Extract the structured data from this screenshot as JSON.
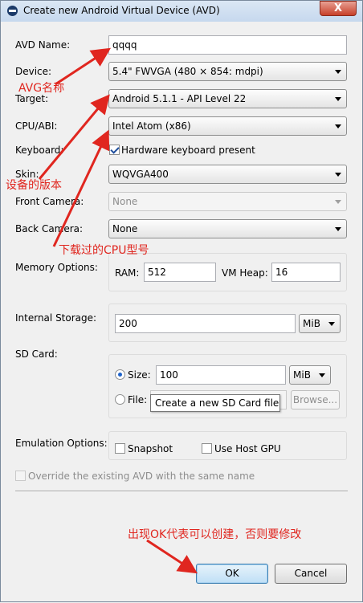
{
  "window": {
    "title": "Create new Android Virtual Device (AVD)",
    "close_label": "X"
  },
  "labels": {
    "avd_name": "AVD Name:",
    "device": "Device:",
    "target": "Target:",
    "cpu_abi": "CPU/ABI:",
    "keyboard": "Keyboard:",
    "skin": "Skin:",
    "front_camera": "Front Camera:",
    "back_camera": "Back Camera:",
    "memory_options": "Memory Options:",
    "ram": "RAM:",
    "vm_heap": "VM Heap:",
    "internal_storage": "Internal Storage:",
    "sd_card": "SD Card:",
    "size": "Size:",
    "file": "File:",
    "emulation_options": "Emulation Options:"
  },
  "fields": {
    "avd_name": "qqqq",
    "device": "5.4\" FWVGA (480 × 854: mdpi)",
    "target": "Android 5.1.1 - API Level 22",
    "cpu_abi": "Intel Atom (x86)",
    "keyboard_label": "Hardware keyboard present",
    "keyboard_checked": true,
    "skin": "WQVGA400",
    "front_camera": "None",
    "back_camera": "None",
    "ram": "512",
    "vm_heap": "16",
    "internal_storage": "200",
    "internal_storage_unit": "MiB",
    "sd_size": "100",
    "sd_size_unit": "MiB",
    "sd_size_selected": true,
    "browse_label": "Browse...",
    "snapshot_label": "Snapshot",
    "use_host_gpu_label": "Use Host GPU",
    "override_label": "Override the existing AVD with the same name"
  },
  "tooltip": "Create a new SD Card file",
  "buttons": {
    "ok": "OK",
    "cancel": "Cancel"
  },
  "annotations": {
    "avd_name_note": "AVG名称",
    "device_note": "设备的版本",
    "cpu_note": "下载过的CPU型号",
    "ok_note": "出现OK代表可以创建，否则要修改"
  },
  "colors": {
    "annotation": "#e0261f",
    "titlebar": "#c6d8ee",
    "close_button": "#c7402a"
  }
}
